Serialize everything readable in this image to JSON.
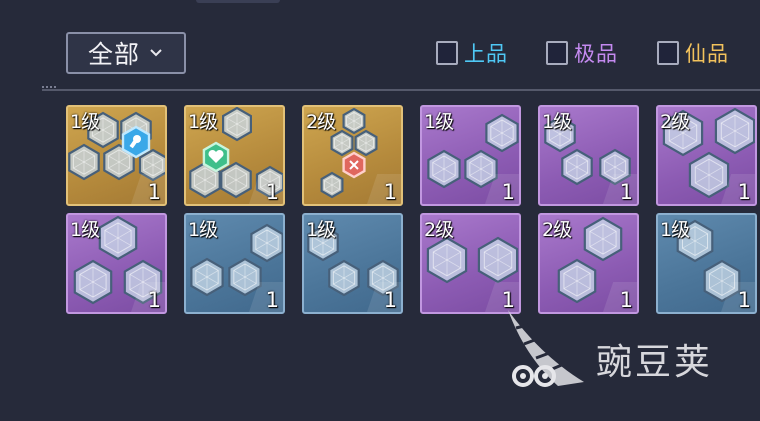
{
  "header": {
    "dropdown_label": "全部"
  },
  "filters": [
    {
      "label": "上品",
      "color": "#4fc8f5",
      "checked": false
    },
    {
      "label": "极品",
      "color": "#c48af0",
      "checked": false
    },
    {
      "label": "仙品",
      "color": "#f2c25c",
      "checked": false
    }
  ],
  "tiles": [
    {
      "rarity": "gold",
      "level": "1级",
      "count": "1",
      "special": "blue-gem-icon"
    },
    {
      "rarity": "gold",
      "level": "1级",
      "count": "1",
      "special": "green-heart-gem-icon"
    },
    {
      "rarity": "gold",
      "level": "2级",
      "count": "1",
      "special": "red-cross-gem-icon"
    },
    {
      "rarity": "purple",
      "level": "1级",
      "count": "1",
      "special": ""
    },
    {
      "rarity": "purple",
      "level": "1级",
      "count": "1",
      "special": ""
    },
    {
      "rarity": "purple",
      "level": "2级",
      "count": "1",
      "special": ""
    },
    {
      "rarity": "purple",
      "level": "1级",
      "count": "1",
      "special": ""
    },
    {
      "rarity": "blue",
      "level": "1级",
      "count": "1",
      "special": ""
    },
    {
      "rarity": "blue",
      "level": "1级",
      "count": "1",
      "special": ""
    },
    {
      "rarity": "purple",
      "level": "2级",
      "count": "1",
      "special": ""
    },
    {
      "rarity": "purple",
      "level": "2级",
      "count": "1",
      "special": ""
    },
    {
      "rarity": "blue",
      "level": "1级",
      "count": "1",
      "special": ""
    }
  ],
  "watermark": {
    "text": "豌豆荚"
  }
}
